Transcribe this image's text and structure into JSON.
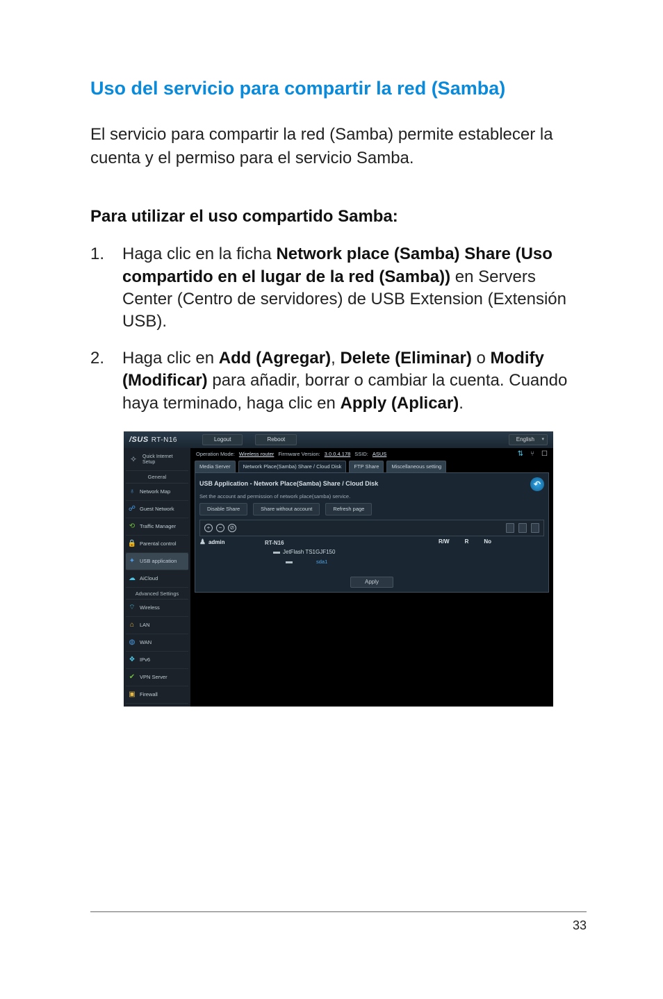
{
  "page": {
    "section_title": "Uso del servicio para compartir la red (Samba)",
    "intro_text": "El servicio para compartir la red (Samba) permite establecer la cuenta y el permiso para el servicio Samba.",
    "steps_title": "Para utilizar el uso compartido Samba:",
    "steps": [
      {
        "pre": "Haga clic en la ficha ",
        "b1": "Network place (Samba) Share (Uso compartido en el lugar de la red (Samba))",
        "mid": " en Servers Center (Centro de servidores) de USB Extension (Extensión USB).",
        "b2": "",
        "post": ""
      },
      {
        "pre": "Haga clic en ",
        "b1": "Add (Agregar)",
        "mid": ", ",
        "b2": "Delete (Eliminar)",
        "mid2": " o ",
        "b3": "Modify (Modificar)",
        "mid3": " para añadir, borrar o cambiar la cuenta. Cuando haya terminado, haga clic en ",
        "b4": "Apply (Aplicar)",
        "post": "."
      }
    ],
    "page_number": "33"
  },
  "screenshot": {
    "brand": "/SUS",
    "model": "RT-N16",
    "top_buttons": {
      "logout": "Logout",
      "reboot": "Reboot"
    },
    "language": "English",
    "sidebar": {
      "quick": "Quick Internet\nSetup",
      "general_heading": "General",
      "advanced_heading": "Advanced Settings",
      "general_items": [
        {
          "label": "Network Map"
        },
        {
          "label": "Guest Network"
        },
        {
          "label": "Traffic Manager"
        },
        {
          "label": "Parental control"
        },
        {
          "label": "USB application"
        },
        {
          "label": "AiCloud"
        }
      ],
      "advanced_items": [
        {
          "label": "Wireless"
        },
        {
          "label": "LAN"
        },
        {
          "label": "WAN"
        },
        {
          "label": "IPv6"
        },
        {
          "label": "VPN Server"
        },
        {
          "label": "Firewall"
        }
      ]
    },
    "subheader": {
      "op_mode_label": "Operation Mode:",
      "op_mode_value": "Wireless router",
      "fw_label": "Firmware Version:",
      "fw_value": "3.0.0.4.178",
      "ssid_label": "SSID:",
      "ssid_value": "ASUS"
    },
    "tabs": [
      "Media Server",
      "Network Place(Samba) Share / Cloud Disk",
      "FTP Share",
      "Miscellaneous setting"
    ],
    "panel": {
      "title": "USB Application - Network Place(Samba) Share / Cloud Disk",
      "subtitle": "Set the account and permission of network place(samba) service.",
      "buttons": {
        "disable": "Disable Share",
        "share_wo": "Share without account",
        "refresh": "Refresh page"
      },
      "account": {
        "user_name": "admin",
        "device": "RT-N16",
        "folder": "JetFlash TS1GJF150",
        "sub": "sda1",
        "perm_headers": {
          "rw": "R/W",
          "r": "R",
          "no": "No"
        }
      },
      "apply_label": "Apply"
    }
  },
  "chart_data": null
}
